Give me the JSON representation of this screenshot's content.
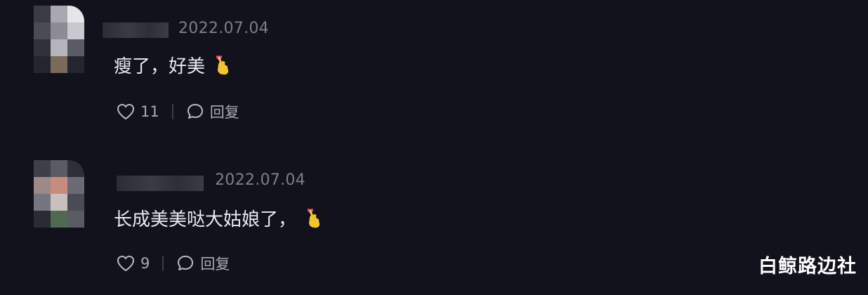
{
  "comments": [
    {
      "timestamp": "2022.07.04",
      "text": "瘦了，好美",
      "emoji": "finger-heart",
      "likes": "11",
      "reply_label": "回复",
      "avatar_pixels": [
        "#3a3b44",
        "#a8a8ae",
        "#e6e6ea",
        "#4a4b54",
        "#8c8c94",
        "#c8c8ce",
        "#30313a",
        "#b4b4ba",
        "#5a5b64",
        "#24252e",
        "#7a6a5a",
        "#24252e"
      ]
    },
    {
      "timestamp": "2022.07.04",
      "text": "长成美美哒大姑娘了，",
      "emoji": "finger-heart",
      "likes": "9",
      "reply_label": "回复",
      "avatar_pixels": [
        "#3e3f48",
        "#5a5b64",
        "#2e2f38",
        "#9c8a84",
        "#c88c7a",
        "#6a6b74",
        "#747680",
        "#c8c0bc",
        "#4a4b54",
        "#2a2b34",
        "#4e6a52",
        "#5a5b64"
      ]
    }
  ],
  "watermark": "白鲸路边社"
}
